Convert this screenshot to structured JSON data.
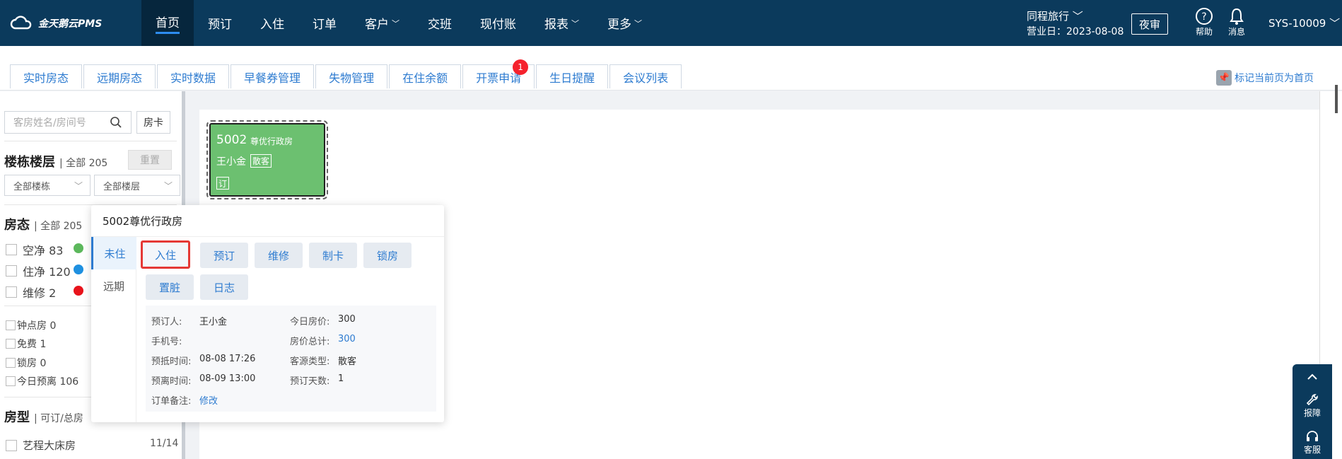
{
  "app": {
    "logo_text": "金天鹅云PMS"
  },
  "nav": {
    "items": [
      {
        "label": "首页",
        "active": true
      },
      {
        "label": "预订"
      },
      {
        "label": "入住"
      },
      {
        "label": "订单"
      },
      {
        "label": "客户",
        "caret": "﹀"
      },
      {
        "label": "交班"
      },
      {
        "label": "现付账"
      },
      {
        "label": "报表",
        "caret": "﹀"
      },
      {
        "label": "更多",
        "caret": "﹀"
      }
    ]
  },
  "header": {
    "hotel_name": "同程旅行 ﹀",
    "business_date": "营业日：2023-08-08",
    "night_audit": "夜审",
    "help": "帮助",
    "messages": "消息",
    "user": "SYS-10009 ﹀"
  },
  "tabs": {
    "items": [
      "实时房态",
      "远期房态",
      "实时数据",
      "早餐券管理",
      "失物管理",
      "在住余额",
      "开票申请",
      "生日提醒",
      "会议列表"
    ],
    "badge_tab": "开票申请",
    "badge_count": "1",
    "pin_label": "标记当前页为首页"
  },
  "sidebar": {
    "search_placeholder": "客房姓名/房间号",
    "room_card_btn": "房卡",
    "building_title": "楼栋楼层",
    "building_count": "全部 205",
    "reset": "重置",
    "building_select": "全部楼栋",
    "floor_select": "全部楼层",
    "status_title": "房态",
    "status_count": "全部 205",
    "status_items": [
      {
        "label": "空净 83",
        "color": "#5cb85c"
      },
      {
        "label": "住净 120",
        "color": "#1e90e0"
      },
      {
        "label": "维修 2",
        "color": "#e8131b"
      }
    ],
    "extra_items": [
      "钟点房 0",
      "免费 1",
      "锁房 0",
      "今日预离 106"
    ],
    "type_title": "房型",
    "type_sub": "可订/总房",
    "type_items": [
      {
        "label": "艺程大床房",
        "count": "11/14"
      }
    ]
  },
  "room": {
    "number": "5002",
    "type": "尊优行政房",
    "guest": "王小金",
    "guest_tag": "散客",
    "booking_mark": "订"
  },
  "popover": {
    "title": "5002尊优行政房",
    "side_tabs": [
      "未住",
      "远期"
    ],
    "actions": [
      "入住",
      "预订",
      "维修",
      "制卡",
      "锁房",
      "置脏",
      "日志"
    ],
    "info": {
      "booker_label": "预订人:",
      "booker": "王小金",
      "phone_label": "手机号:",
      "phone": "",
      "arrive_label": "预抵时间:",
      "arrive": "08-08 17:26",
      "depart_label": "预离时间:",
      "depart": "08-09 13:00",
      "note_label": "订单备注:",
      "note_link": "修改",
      "rate_label": "今日房价:",
      "rate": "300",
      "total_label": "房价总计:",
      "total": "300",
      "source_label": "客源类型:",
      "source": "散客",
      "days_label": "预订天数:",
      "days": "1"
    }
  },
  "float_panel": {
    "report": "报障",
    "service": "客服"
  }
}
